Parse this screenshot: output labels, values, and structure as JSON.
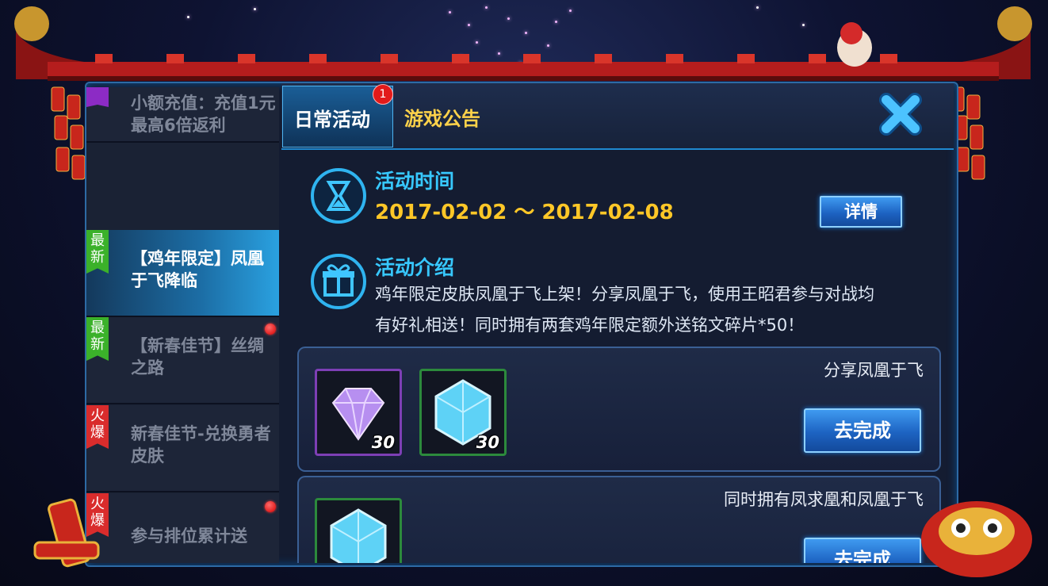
{
  "tabs": [
    {
      "label": "日常活动",
      "badge": "1"
    },
    {
      "label": "游戏公告"
    }
  ],
  "sidebar": {
    "items": [
      {
        "ribbon": "",
        "ribbon_color": "purple",
        "text": "小额充值：充值1元最高6倍返利",
        "dot": false
      },
      {
        "ribbon": "最新",
        "ribbon_color": "green",
        "text": "【鸡年限定】凤凰于飞降临",
        "dot": false,
        "active": true
      },
      {
        "ribbon": "最新",
        "ribbon_color": "green",
        "text": "【新春佳节】丝绸之路",
        "dot": true
      },
      {
        "ribbon": "火爆",
        "ribbon_color": "red",
        "text": "新春佳节-兑换勇者皮肤",
        "dot": false
      },
      {
        "ribbon": "火爆",
        "ribbon_color": "red",
        "text": "参与排位累计送",
        "dot": true
      }
    ]
  },
  "activity": {
    "time_title": "活动时间",
    "date_range": "2017-02-02 ～ 2017-02-08",
    "details_label": "详情",
    "intro_title": "活动介绍",
    "intro_line1": "鸡年限定皮肤凤凰于飞上架！分享凤凰于飞，使用王昭君参与对战均",
    "intro_line2": "有好礼相送！同时拥有两套鸡年限定额外送铭文碎片*50！"
  },
  "tasks": [
    {
      "label": "分享凤凰于飞",
      "button": "去完成",
      "rewards": [
        {
          "icon": "purple-diamond-icon",
          "qty": "30"
        },
        {
          "icon": "blue-crystal-icon",
          "qty": "30"
        }
      ]
    },
    {
      "label": "同时拥有凤求凰和凤凰于飞",
      "button": "去完成",
      "rewards": [
        {
          "icon": "blue-crystal-icon",
          "qty": ""
        }
      ]
    }
  ],
  "colors": {
    "accent_cyan": "#37c8ff",
    "date_yellow": "#ffc727",
    "tab_gold": "#ffd24a",
    "new_green": "#3bb12a",
    "hot_red": "#d92c2c"
  }
}
